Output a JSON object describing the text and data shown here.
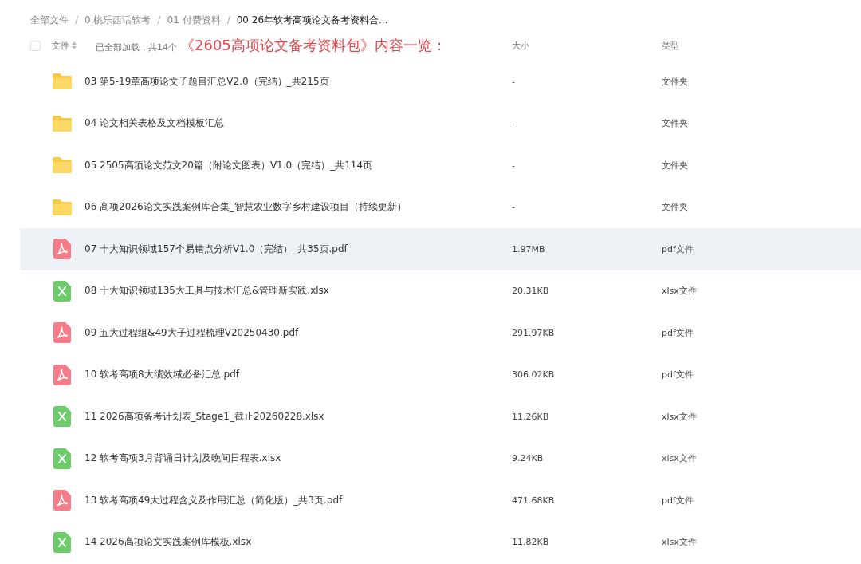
{
  "breadcrumb": [
    {
      "kind": "link",
      "label": "全部文件",
      "current": false
    },
    {
      "kind": "separator",
      "label": "/"
    },
    {
      "kind": "link",
      "label": "0.桃乐西话软考",
      "current": false
    },
    {
      "kind": "separator",
      "label": "/"
    },
    {
      "kind": "link",
      "label": "01 付费资料",
      "current": false
    },
    {
      "kind": "separator",
      "label": "/"
    },
    {
      "kind": "link",
      "label": "00 26年软考高项论文备考资料合...",
      "current": true
    }
  ],
  "header": {
    "select_all": {
      "checked": false
    },
    "name_label": "文件",
    "loaded_text": "已全部加载，共14个",
    "annotation": "《2605高项论文备考资料包》内容一览：",
    "size_label": "大小",
    "type_label": "类型"
  },
  "rows": [
    {
      "kind": "folder",
      "name": "03 第5-19章高项论文子题目汇总V2.0（完结）_共215页",
      "size": "-",
      "type": "文件夹",
      "highlighted": false
    },
    {
      "kind": "folder",
      "name": "04 论文相关表格及文档模板汇总",
      "size": "-",
      "type": "文件夹",
      "highlighted": false
    },
    {
      "kind": "folder",
      "name": "05 2505高项论文范文20篇（附论文图表）V1.0（完结）_共114页",
      "size": "-",
      "type": "文件夹",
      "highlighted": false
    },
    {
      "kind": "folder",
      "name": "06 高项2026论文实践案例库合集_智慧农业数字乡村建设项目（持续更新）",
      "size": "-",
      "type": "文件夹",
      "highlighted": false
    },
    {
      "kind": "pdf",
      "name": "07 十大知识领域157个易错点分析V1.0（完结）_共35页.pdf",
      "size": "1.97MB",
      "type": "pdf文件",
      "highlighted": true
    },
    {
      "kind": "xlsx",
      "name": "08 十大知识领域135大工具与技术汇总&管理新实践.xlsx",
      "size": "20.31KB",
      "type": "xlsx文件",
      "highlighted": false
    },
    {
      "kind": "pdf",
      "name": "09 五大过程组&49大子过程梳理V20250430.pdf",
      "size": "291.97KB",
      "type": "pdf文件",
      "highlighted": false
    },
    {
      "kind": "pdf",
      "name": "10 软考高项8大绩效域必备汇总.pdf",
      "size": "306.02KB",
      "type": "pdf文件",
      "highlighted": false
    },
    {
      "kind": "xlsx",
      "name": "11 2026高项备考计划表_Stage1_截止20260228.xlsx",
      "size": "11.26KB",
      "type": "xlsx文件",
      "highlighted": false
    },
    {
      "kind": "xlsx",
      "name": "12 软考高项3月背诵日计划及晚间日程表.xlsx",
      "size": "9.24KB",
      "type": "xlsx文件",
      "highlighted": false
    },
    {
      "kind": "pdf",
      "name": "13 软考高项49大过程含义及作用汇总（简化版）_共3页.pdf",
      "size": "471.68KB",
      "type": "pdf文件",
      "highlighted": false
    },
    {
      "kind": "xlsx",
      "name": "14 2026高项论文实践案例库模板.xlsx",
      "size": "11.82KB",
      "type": "xlsx文件",
      "highlighted": false
    }
  ]
}
